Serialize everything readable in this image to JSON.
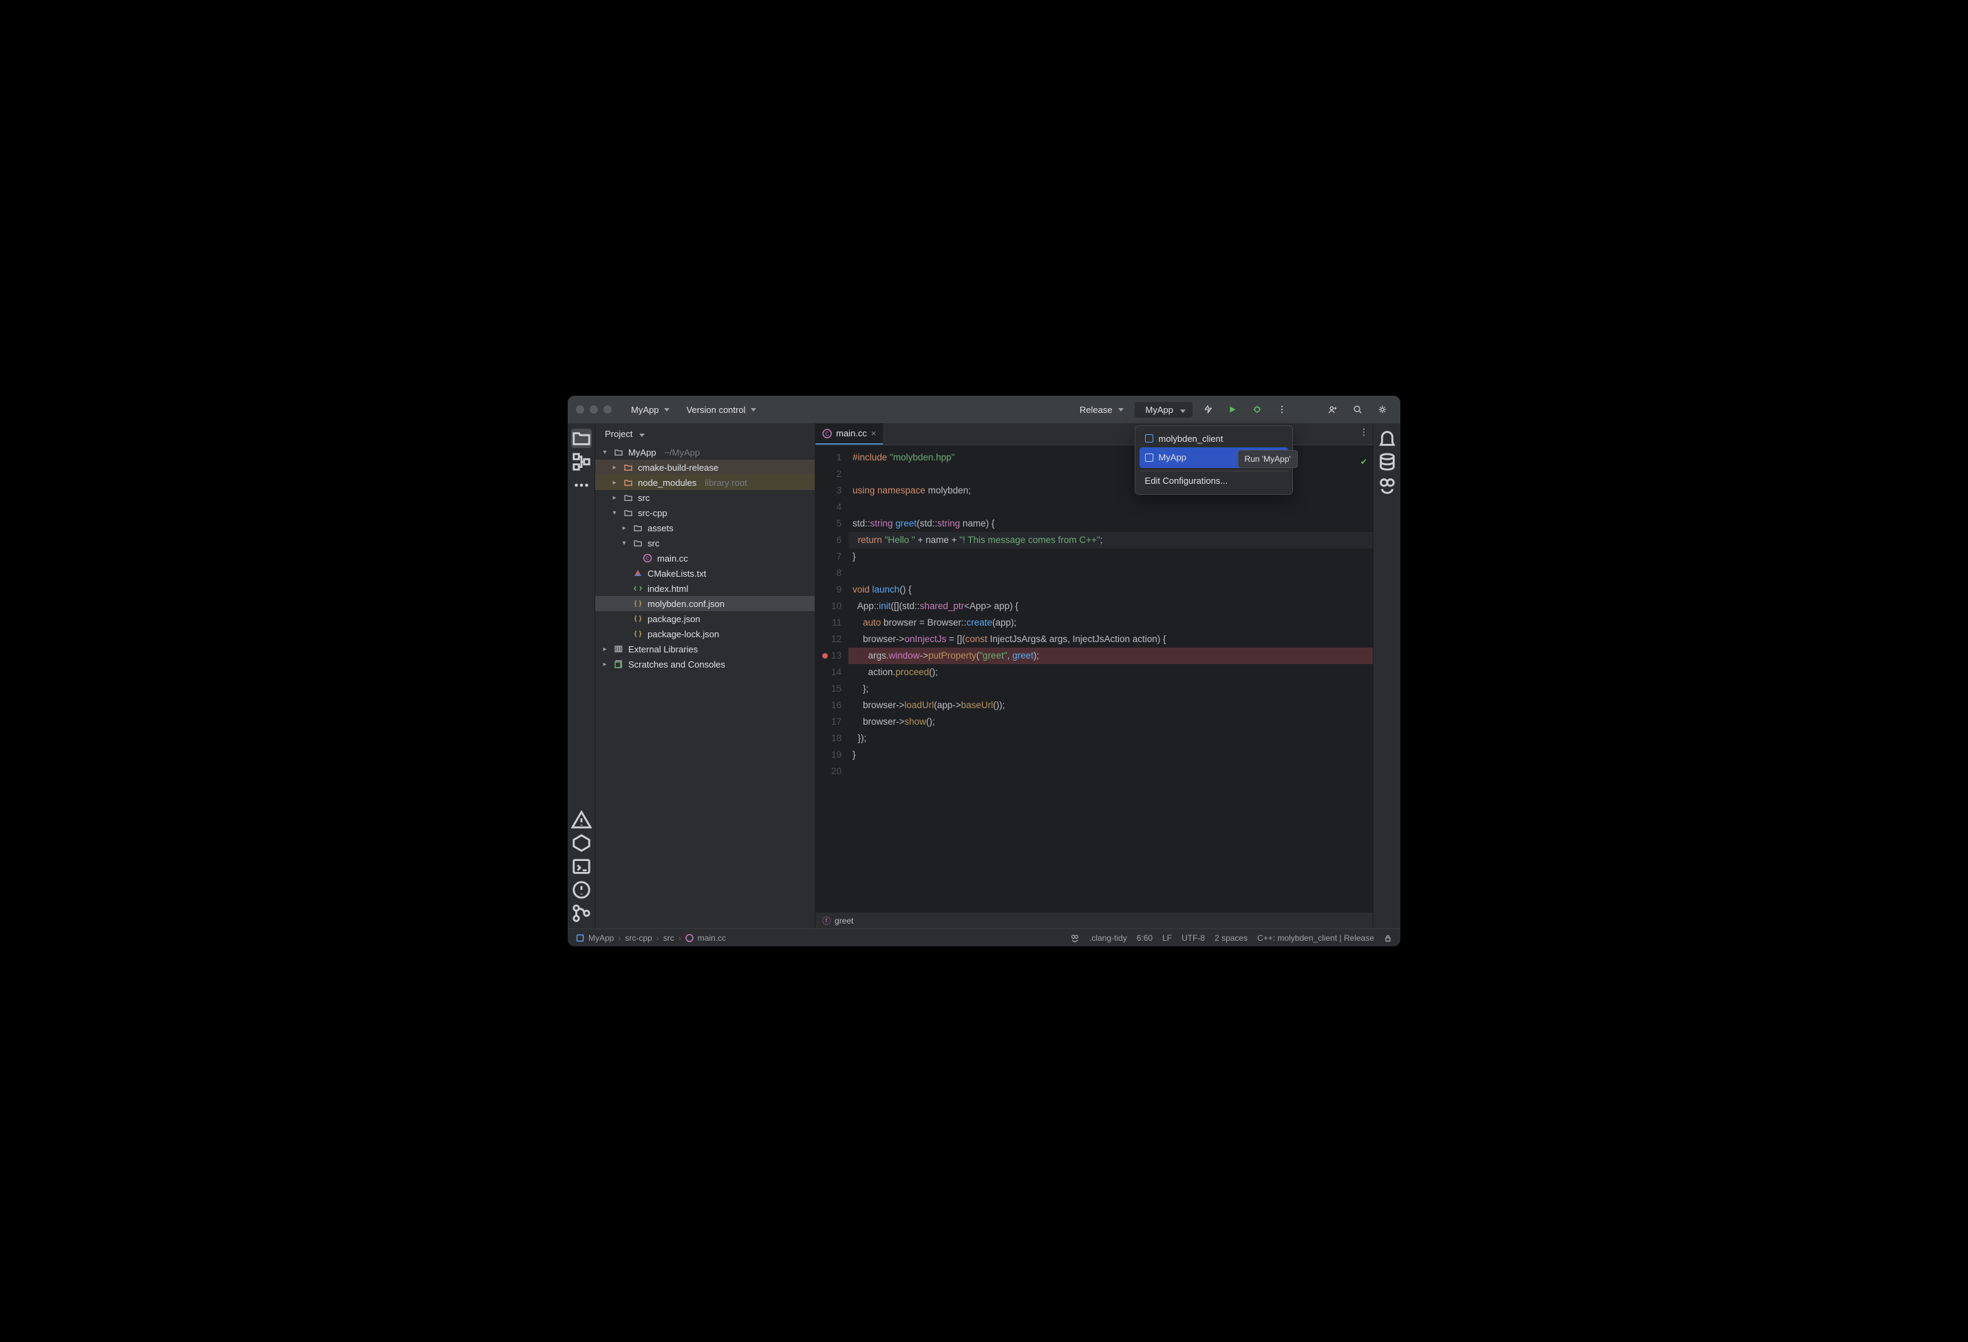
{
  "titlebar": {
    "app_menu": "MyApp",
    "vcs_menu": "Version control",
    "build_config": "Release",
    "run_config": "MyApp"
  },
  "popup": {
    "items": [
      "molybden_client",
      "MyApp"
    ],
    "selected": "MyApp",
    "footer": "Edit Configurations...",
    "tooltip": "Run 'MyApp'"
  },
  "project": {
    "title": "Project",
    "tree": [
      {
        "depth": 0,
        "arrow": "down",
        "icon": "folder",
        "label": "MyApp",
        "suffix": "~/MyApp"
      },
      {
        "depth": 1,
        "arrow": "right",
        "icon": "folder-o",
        "label": "cmake-build-release",
        "hl": "hl1"
      },
      {
        "depth": 1,
        "arrow": "right",
        "icon": "folder-o",
        "label": "node_modules",
        "suffix": "library root",
        "hl": "hl2"
      },
      {
        "depth": 1,
        "arrow": "right",
        "icon": "folder",
        "label": "src"
      },
      {
        "depth": 1,
        "arrow": "down",
        "icon": "folder",
        "label": "src-cpp"
      },
      {
        "depth": 2,
        "arrow": "right",
        "icon": "folder",
        "label": "assets"
      },
      {
        "depth": 2,
        "arrow": "down",
        "icon": "folder",
        "label": "src"
      },
      {
        "depth": 3,
        "arrow": "",
        "icon": "cpp",
        "label": "main.cc"
      },
      {
        "depth": 2,
        "arrow": "",
        "icon": "cmake",
        "label": "CMakeLists.txt"
      },
      {
        "depth": 2,
        "arrow": "",
        "icon": "html",
        "label": "index.html"
      },
      {
        "depth": 2,
        "arrow": "",
        "icon": "json",
        "label": "molybden.conf.json",
        "sel": true
      },
      {
        "depth": 2,
        "arrow": "",
        "icon": "json",
        "label": "package.json"
      },
      {
        "depth": 2,
        "arrow": "",
        "icon": "json",
        "label": "package-lock.json"
      },
      {
        "depth": 0,
        "arrow": "right",
        "icon": "lib",
        "label": "External Libraries"
      },
      {
        "depth": 0,
        "arrow": "right",
        "icon": "scratch",
        "label": "Scratches and Consoles"
      }
    ]
  },
  "editor": {
    "tab": "main.cc",
    "crumb_icon": "f",
    "crumb": "greet",
    "line_count": 20,
    "current_line_hl": 6,
    "breakpoint_line": 13,
    "code": [
      [
        {
          "c": "kw",
          "t": "#include"
        },
        {
          "c": "pl",
          "t": " "
        },
        {
          "c": "str",
          "t": "\"molybden.hpp\""
        }
      ],
      [],
      [
        {
          "c": "kw",
          "t": "using namespace "
        },
        {
          "c": "pl",
          "t": "molybden;"
        }
      ],
      [],
      [
        {
          "c": "pl",
          "t": "std::"
        },
        {
          "c": "ty",
          "t": "string"
        },
        {
          "c": "pl",
          "t": " "
        },
        {
          "c": "fn",
          "t": "greet"
        },
        {
          "c": "pl",
          "t": "(std::"
        },
        {
          "c": "ty",
          "t": "string"
        },
        {
          "c": "pl",
          "t": " "
        },
        {
          "c": "arg",
          "t": "name"
        },
        {
          "c": "pl",
          "t": ") {"
        }
      ],
      [
        {
          "c": "pl",
          "t": "  "
        },
        {
          "c": "kw",
          "t": "return"
        },
        {
          "c": "pl",
          "t": " "
        },
        {
          "c": "str",
          "t": "\"Hello \""
        },
        {
          "c": "pl",
          "t": " + "
        },
        {
          "c": "arg",
          "t": "name"
        },
        {
          "c": "pl",
          "t": " + "
        },
        {
          "c": "str",
          "t": "\"! This message comes from C++\""
        },
        {
          "c": "pl",
          "t": ";"
        }
      ],
      [
        {
          "c": "pl",
          "t": "}"
        }
      ],
      [],
      [
        {
          "c": "kw",
          "t": "void"
        },
        {
          "c": "pl",
          "t": " "
        },
        {
          "c": "fn",
          "t": "launch"
        },
        {
          "c": "pl",
          "t": "() {"
        }
      ],
      [
        {
          "c": "pl",
          "t": "  App::"
        },
        {
          "c": "fn",
          "t": "init"
        },
        {
          "c": "pl",
          "t": "([](std::"
        },
        {
          "c": "ty",
          "t": "shared_ptr"
        },
        {
          "c": "pl",
          "t": "<App> "
        },
        {
          "c": "arg",
          "t": "app"
        },
        {
          "c": "pl",
          "t": ") {"
        }
      ],
      [
        {
          "c": "pl",
          "t": "    "
        },
        {
          "c": "kw",
          "t": "auto"
        },
        {
          "c": "pl",
          "t": " browser = Browser::"
        },
        {
          "c": "fn",
          "t": "create"
        },
        {
          "c": "pl",
          "t": "("
        },
        {
          "c": "arg",
          "t": "app"
        },
        {
          "c": "pl",
          "t": ");"
        }
      ],
      [
        {
          "c": "pl",
          "t": "    browser->"
        },
        {
          "c": "prop",
          "t": "onInjectJs"
        },
        {
          "c": "pl",
          "t": " = []("
        },
        {
          "c": "kw",
          "t": "const"
        },
        {
          "c": "pl",
          "t": " InjectJsArgs& "
        },
        {
          "c": "arg",
          "t": "args"
        },
        {
          "c": "pl",
          "t": ", InjectJsAction "
        },
        {
          "c": "arg",
          "t": "action"
        },
        {
          "c": "pl",
          "t": ") {"
        }
      ],
      [
        {
          "c": "pl",
          "t": "      "
        },
        {
          "c": "arg",
          "t": "args"
        },
        {
          "c": "pl",
          "t": "."
        },
        {
          "c": "prop",
          "t": "window"
        },
        {
          "c": "pl",
          "t": "->"
        },
        {
          "c": "call",
          "t": "putProperty"
        },
        {
          "c": "pl",
          "t": "("
        },
        {
          "c": "str",
          "t": "\"greet\""
        },
        {
          "c": "pl",
          "t": ", "
        },
        {
          "c": "fn",
          "t": "greet"
        },
        {
          "c": "pl",
          "t": ");"
        }
      ],
      [
        {
          "c": "pl",
          "t": "      "
        },
        {
          "c": "arg",
          "t": "action"
        },
        {
          "c": "pl",
          "t": "."
        },
        {
          "c": "call",
          "t": "proceed"
        },
        {
          "c": "pl",
          "t": "();"
        }
      ],
      [
        {
          "c": "pl",
          "t": "    };"
        }
      ],
      [
        {
          "c": "pl",
          "t": "    browser->"
        },
        {
          "c": "call",
          "t": "loadUrl"
        },
        {
          "c": "pl",
          "t": "("
        },
        {
          "c": "arg",
          "t": "app"
        },
        {
          "c": "pl",
          "t": "->"
        },
        {
          "c": "call",
          "t": "baseUrl"
        },
        {
          "c": "pl",
          "t": "());"
        }
      ],
      [
        {
          "c": "pl",
          "t": "    browser->"
        },
        {
          "c": "call",
          "t": "show"
        },
        {
          "c": "pl",
          "t": "();"
        }
      ],
      [
        {
          "c": "pl",
          "t": "  });"
        }
      ],
      [
        {
          "c": "pl",
          "t": "}"
        }
      ],
      []
    ]
  },
  "status": {
    "breadcrumb": [
      "MyApp",
      "src-cpp",
      "src",
      "main.cc"
    ],
    "items": [
      ".clang-tidy",
      "6:60",
      "LF",
      "UTF-8",
      "2 spaces",
      "C++: molybden_client | Release"
    ]
  }
}
